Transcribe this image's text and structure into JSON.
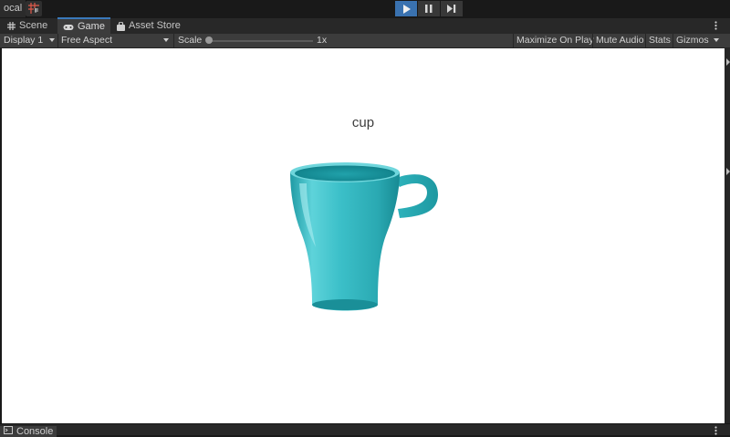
{
  "toolbar": {
    "layers_label": "ocal",
    "play_icon": "play-icon",
    "pause_icon": "pause-icon",
    "step_icon": "step-icon",
    "play_active": true
  },
  "tabs": [
    {
      "label": "Scene",
      "icon": "grid-icon"
    },
    {
      "label": "Game",
      "icon": "gamepad-icon",
      "active": true
    },
    {
      "label": "Asset Store",
      "icon": "shopping-bag-icon"
    }
  ],
  "game_toolbar": {
    "display": "Display 1",
    "aspect": "Free Aspect",
    "scale_label": "Scale",
    "scale_value": "1x",
    "scale_fraction": 0.0,
    "maximize": "Maximize On Play",
    "mute": "Mute Audio",
    "stats": "Stats",
    "gizmos": "Gizmos"
  },
  "game_view": {
    "label": "cup",
    "object_icon": "cup-image"
  },
  "bottom": {
    "console_label": "Console"
  },
  "colors": {
    "accent": "#3a72b0",
    "cup": "#3fc3cb"
  }
}
